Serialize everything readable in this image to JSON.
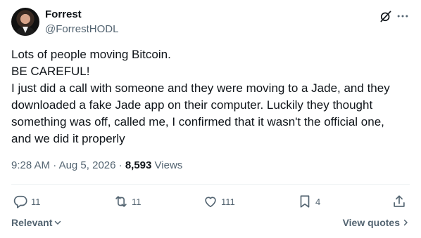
{
  "author": {
    "name": "Forrest",
    "handle": "@ForrestHODL"
  },
  "tweet": {
    "lines": [
      "Lots of people moving Bitcoin.",
      "BE CAREFUL!",
      "I just did a call with someone and they were moving to a Jade, and they",
      "downloaded a fake Jade app on their computer. Luckily they thought",
      "something was off, called me, I confirmed that it wasn't the official one,",
      "and we did it properly"
    ]
  },
  "meta": {
    "time": "9:28 AM",
    "separator": " · ",
    "date": "Aug 5, 2026",
    "views_count": "8,593",
    "views_label": "Views"
  },
  "actions": {
    "replies": "11",
    "reposts": "11",
    "likes": "111",
    "bookmarks": "4"
  },
  "footer": {
    "sort_label": "Relevant",
    "view_quotes_label": "View quotes"
  },
  "colors": {
    "text": "#0f1419",
    "secondary": "#536471",
    "divider": "#eff3f4"
  },
  "icons": [
    "grok-icon",
    "more-icon",
    "reply-icon",
    "repost-icon",
    "like-icon",
    "bookmark-icon",
    "share-icon",
    "chevron-down-icon",
    "chevron-right-icon"
  ]
}
